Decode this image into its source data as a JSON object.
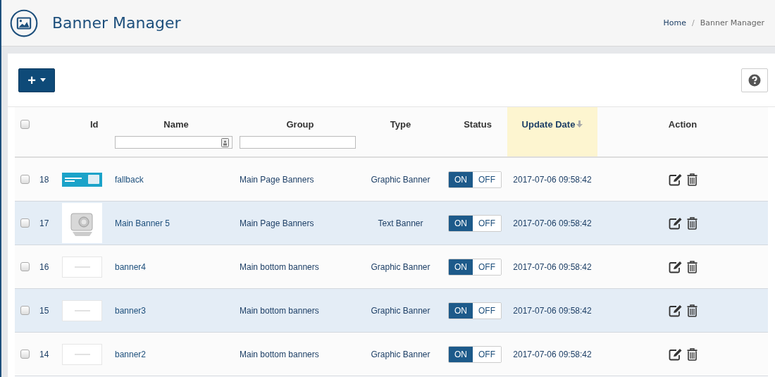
{
  "header": {
    "title": "Banner Manager",
    "breadcrumb": {
      "separator": "/",
      "items": [
        {
          "label": "Home",
          "current": false
        },
        {
          "label": "Banner Manager",
          "current": true
        }
      ]
    }
  },
  "toolbar": {
    "add_button": "+"
  },
  "table": {
    "columns": [
      {
        "label": "Id",
        "filter": false,
        "sorted": false
      },
      {
        "label": "Name",
        "filter": true,
        "sorted": false
      },
      {
        "label": "Group",
        "filter": true,
        "sorted": false
      },
      {
        "label": "Type",
        "filter": false,
        "sorted": false
      },
      {
        "label": "Status",
        "filter": false,
        "sorted": false
      },
      {
        "label": "Update Date",
        "filter": false,
        "sorted": true
      },
      {
        "label": "Action",
        "filter": false,
        "sorted": false
      }
    ],
    "select_all_checked": false,
    "rows": [
      {
        "checked": false,
        "id": "18",
        "kind": "graphic",
        "name": "fallback",
        "group": "Main Page Banners",
        "type": "Graphic Banner",
        "on": true,
        "on_label": "ON",
        "off_label": "OFF",
        "updated": "2017-07-06 09:58:42"
      },
      {
        "checked": false,
        "id": "17",
        "kind": "photo",
        "name": "Main Banner 5",
        "group": "Main Page Banners",
        "type": "Text Banner",
        "on": true,
        "on_label": "ON",
        "off_label": "OFF",
        "updated": "2017-07-06 09:58:42"
      },
      {
        "checked": false,
        "id": "16",
        "kind": "placeholder",
        "name": "banner4",
        "group": "Main bottom banners",
        "type": "Graphic Banner",
        "on": true,
        "on_label": "ON",
        "off_label": "OFF",
        "updated": "2017-07-06 09:58:42"
      },
      {
        "checked": false,
        "id": "15",
        "kind": "placeholder",
        "name": "banner3",
        "group": "Main bottom banners",
        "type": "Graphic Banner",
        "on": true,
        "on_label": "ON",
        "off_label": "OFF",
        "updated": "2017-07-06 09:58:42"
      },
      {
        "checked": false,
        "id": "14",
        "kind": "placeholder",
        "name": "banner2",
        "group": "Main bottom banners",
        "type": "Graphic Banner",
        "on": true,
        "on_label": "ON",
        "off_label": "OFF",
        "updated": "2017-07-06 09:58:42"
      }
    ]
  }
}
